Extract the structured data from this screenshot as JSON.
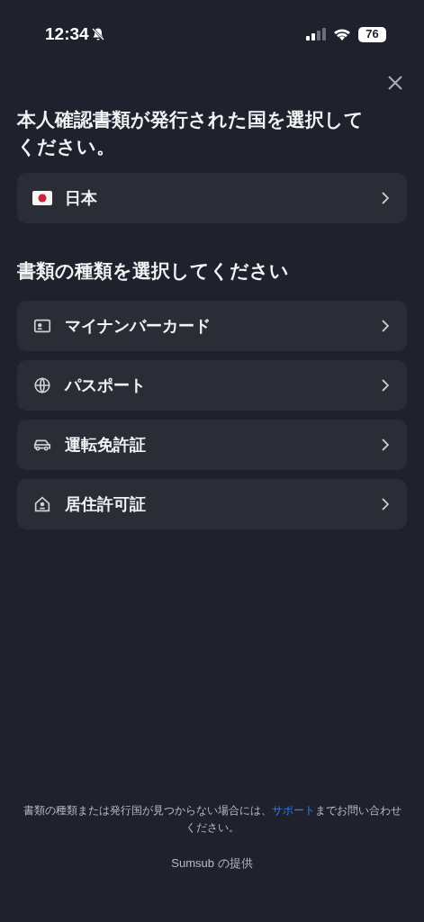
{
  "status_bar": {
    "time": "12:34",
    "battery": "76"
  },
  "country_section": {
    "title": "本人確認書類が発行された国を選択してください。",
    "country": {
      "label": "日本",
      "kind": "flag-jp"
    }
  },
  "document_section": {
    "title": "書類の種類を選択してください",
    "items": [
      {
        "label": "マイナンバーカード",
        "kind": "id-card"
      },
      {
        "label": "パスポート",
        "kind": "globe"
      },
      {
        "label": "運転免許証",
        "kind": "car"
      },
      {
        "label": "居住許可証",
        "kind": "house"
      }
    ]
  },
  "footer": {
    "note_before": "書類の種類または発行国が見つからない場合には、",
    "link": "サポート",
    "note_after": "までお問い合わせください。",
    "powered_by": "Sumsub の提供"
  }
}
